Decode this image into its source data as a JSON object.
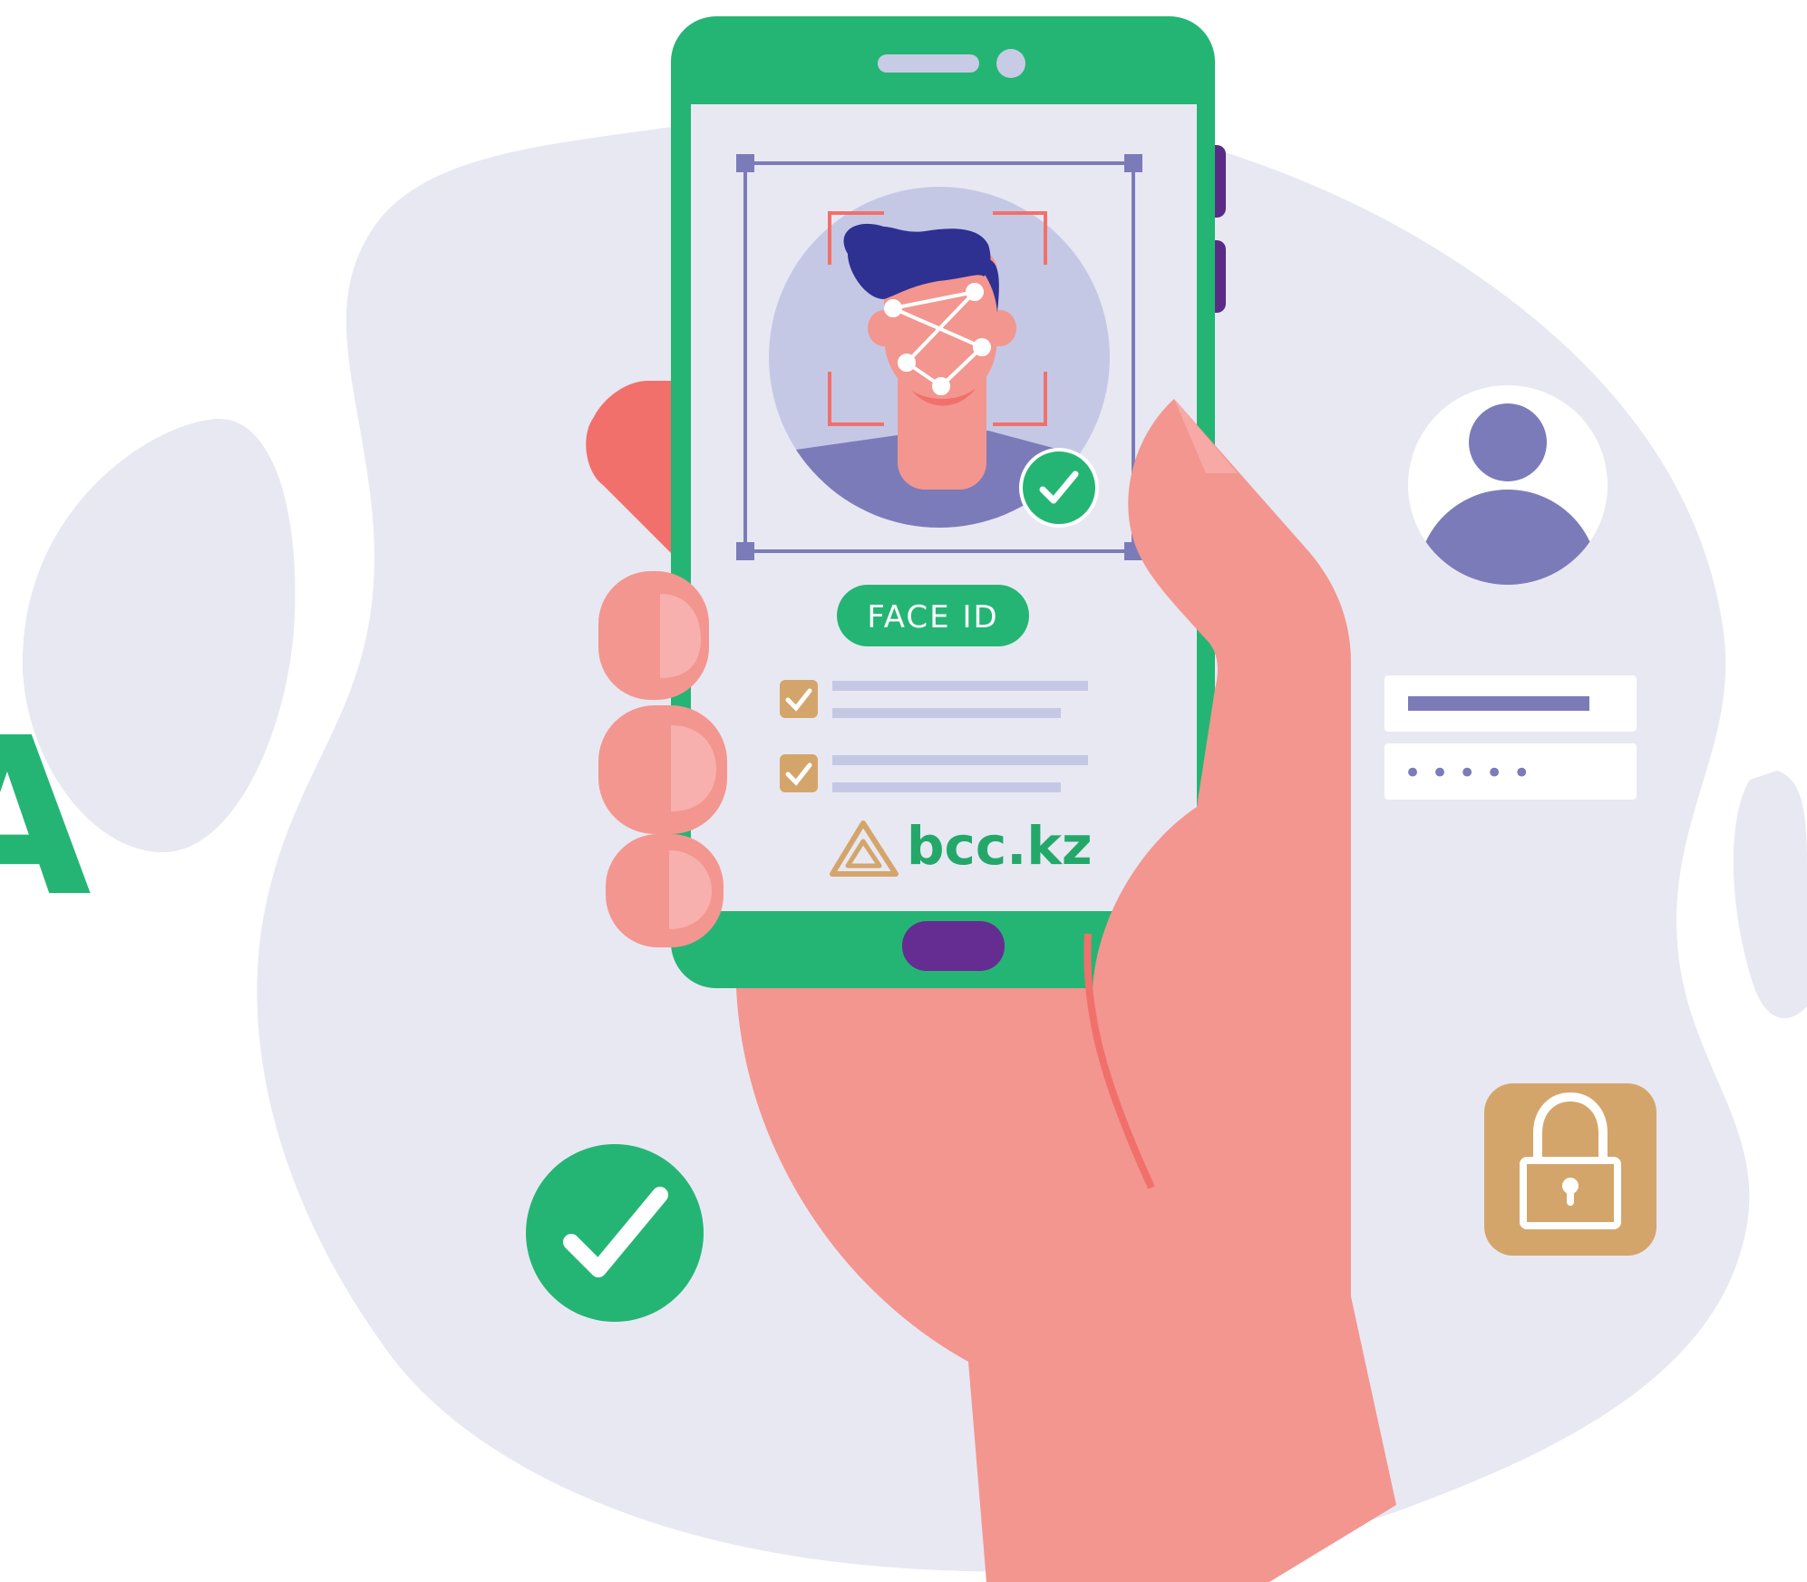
{
  "phone": {
    "badge_label": "FACE ID",
    "brand_label": "bcc.kz",
    "checklist_items": [
      {
        "checked": true
      },
      {
        "checked": true
      }
    ]
  },
  "login_card": {
    "password_mask": "•••••"
  },
  "partial_edge_text": "A",
  "colors": {
    "brand_green": "#24b574",
    "lavender_bg": "#e8e8f3",
    "purple": "#7c7bb9",
    "gold": "#d4a56a",
    "skin": "#f3968f",
    "dark_purple": "#652d91"
  },
  "icons": [
    "face-scan-icon",
    "check-circle-icon",
    "user-avatar-icon",
    "padlock-icon",
    "brand-logo-icon"
  ]
}
